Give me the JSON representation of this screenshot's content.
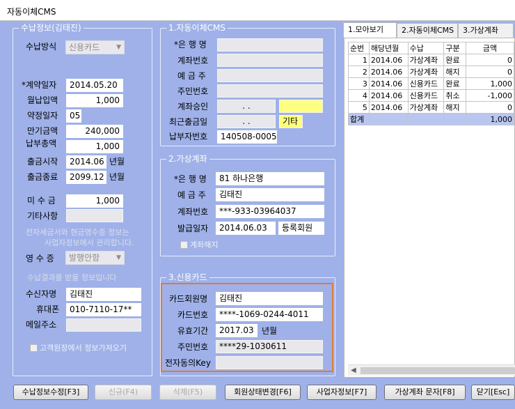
{
  "window": {
    "title": "자동이체CMS"
  },
  "payment_panel": {
    "title": "수납정보(김태진)",
    "method_label": "수납방식",
    "method_value": "신용카드",
    "contract_date_label": "*계약일자",
    "contract_date": "2014.05.20",
    "monthly_amount_label": "월납입액",
    "monthly_amount": "1,000",
    "agreed_day_label": "약정일자",
    "agreed_day": "05",
    "maturity_amount_label": "만기금액",
    "maturity_amount": "240,000",
    "total_paid_label": "납부총액",
    "total_paid": "1,000",
    "start_label": "출금시작",
    "start_value": "2014.06",
    "start_unit": "년월",
    "end_label": "출금종료",
    "end_value": "2099.12",
    "end_unit": "년월",
    "unpaid_label": "미 수 금",
    "unpaid_value": "1,000",
    "other_label": "기타사항",
    "other_value": "",
    "note_line1": "전자세금서와 현금영수증 정보는",
    "note_line2": "사업자정보에서 관리합니다.",
    "receipt_label": "영 수 증",
    "receipt_value": "발행안함",
    "recipient_note": "수납결과를 받을 정보입니다",
    "recipient_label": "수신자명",
    "recipient_value": "김태진",
    "mobile_label": "휴대폰",
    "mobile_value": "010-7110-17**",
    "email_label": "메일주소",
    "email_value": "",
    "import_checkbox_label": "고객원장에서 정보가져오기"
  },
  "auto_transfer": {
    "title": "1.자동이체CMS",
    "bank_label": "*은 행 명",
    "bank_value": "",
    "account_label": "계좌번호",
    "account_value": "",
    "holder_label": "예 금 주",
    "holder_value": "",
    "resident_label": "주민번호",
    "resident_value": "",
    "approval_label": "계좌승인",
    "approval_date": ".  .",
    "approval_extra": "",
    "last_withdraw_label": "최근출금일",
    "last_withdraw_date": ".  .",
    "last_withdraw_type": "기타",
    "payer_no_label": "납부자번호",
    "payer_no_value": "140508-0005"
  },
  "virtual_account": {
    "title": "2.가상계좌",
    "bank_label": "*은 행 명",
    "bank_value": "81 하나은행",
    "holder_label": "예 금 주",
    "holder_value": "김태진",
    "account_label": "계좌번호",
    "account_value": "***-933-03964037",
    "issue_label": "발급일자",
    "issue_date": "2014.06.03",
    "issue_status": "등록회원",
    "cancel_label": "계좌해지"
  },
  "credit_card": {
    "title": "3.신용카드",
    "member_label": "카드회원명",
    "member_value": "김태진",
    "card_no_label": "카드번호",
    "card_no_value": "****-1069-0244-4011",
    "expiry_label": "유효기간",
    "expiry_value": "2017.03",
    "expiry_unit": "년월",
    "resident_label": "주민번호",
    "resident_value": "****29-1030611",
    "consent_label": "전자동의Key",
    "consent_value": ""
  },
  "tabs": [
    "1.모아보기",
    "2.자동이체CMS",
    "3.가상계좌"
  ],
  "grid": {
    "headers": [
      "순번",
      "해당년월",
      "수납",
      "구분",
      "금액"
    ],
    "rows": [
      [
        "1",
        "2014.06",
        "가상계좌",
        "완료",
        "0"
      ],
      [
        "2",
        "2014.06",
        "가상계좌",
        "해지",
        "0"
      ],
      [
        "3",
        "2014.06",
        "신용카드",
        "완료",
        "1,000"
      ],
      [
        "4",
        "2014.06",
        "신용카드",
        "취소",
        "-1,000"
      ],
      [
        "5",
        "2014.06",
        "가상계좌",
        "해지",
        "0"
      ]
    ],
    "total_label": "합계",
    "total_amount": "1,000"
  },
  "buttons": {
    "edit": "수납정보수정[F3]",
    "disabled1": "신규(F4)",
    "disabled2": "삭제(F5)",
    "member_status": "회원상태변경[F6]",
    "business_info": "사업자정보[F7]",
    "virtual_msg": "가상계좌 문자[F8]",
    "close": "닫기[Esc]"
  }
}
